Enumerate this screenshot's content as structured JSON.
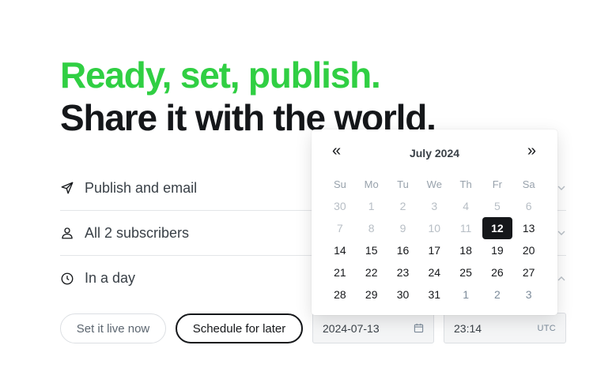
{
  "headline": {
    "line1": "Ready, set, publish.",
    "line2": "Share it with the world."
  },
  "options": [
    {
      "icon": "send-icon",
      "label": "Publish and email"
    },
    {
      "icon": "user-icon",
      "label": "All 2 subscribers"
    },
    {
      "icon": "clock-icon",
      "label": "In a day"
    }
  ],
  "buttons": {
    "live_label": "Set it live now",
    "later_label": "Schedule for later"
  },
  "schedule": {
    "date": "2024-07-13",
    "time": "23:14",
    "timezone": "UTC"
  },
  "calendar": {
    "month_label": "July 2024",
    "prev": "«",
    "next": "»",
    "weekdays": [
      "Su",
      "Mo",
      "Tu",
      "We",
      "Th",
      "Fr",
      "Sa"
    ],
    "weeks": [
      [
        {
          "d": "30",
          "s": "muted"
        },
        {
          "d": "1",
          "s": "muted"
        },
        {
          "d": "2",
          "s": "muted"
        },
        {
          "d": "3",
          "s": "muted"
        },
        {
          "d": "4",
          "s": "muted"
        },
        {
          "d": "5",
          "s": "muted"
        },
        {
          "d": "6",
          "s": "muted"
        }
      ],
      [
        {
          "d": "7",
          "s": "muted"
        },
        {
          "d": "8",
          "s": "muted"
        },
        {
          "d": "9",
          "s": "muted"
        },
        {
          "d": "10",
          "s": "muted"
        },
        {
          "d": "11",
          "s": "muted"
        },
        {
          "d": "12",
          "s": "selected"
        },
        {
          "d": "13",
          "s": "normal"
        }
      ],
      [
        {
          "d": "14",
          "s": "normal"
        },
        {
          "d": "15",
          "s": "normal"
        },
        {
          "d": "16",
          "s": "normal"
        },
        {
          "d": "17",
          "s": "normal"
        },
        {
          "d": "18",
          "s": "normal"
        },
        {
          "d": "19",
          "s": "normal"
        },
        {
          "d": "20",
          "s": "normal"
        }
      ],
      [
        {
          "d": "21",
          "s": "normal"
        },
        {
          "d": "22",
          "s": "normal"
        },
        {
          "d": "23",
          "s": "normal"
        },
        {
          "d": "24",
          "s": "normal"
        },
        {
          "d": "25",
          "s": "normal"
        },
        {
          "d": "26",
          "s": "normal"
        },
        {
          "d": "27",
          "s": "normal"
        }
      ],
      [
        {
          "d": "28",
          "s": "normal"
        },
        {
          "d": "29",
          "s": "normal"
        },
        {
          "d": "30",
          "s": "normal"
        },
        {
          "d": "31",
          "s": "normal"
        },
        {
          "d": "1",
          "s": "faded"
        },
        {
          "d": "2",
          "s": "faded"
        },
        {
          "d": "3",
          "s": "faded"
        }
      ]
    ]
  },
  "colors": {
    "accent_green": "#30cf43",
    "text_dark": "#15171a",
    "muted": "#b7bec5"
  }
}
